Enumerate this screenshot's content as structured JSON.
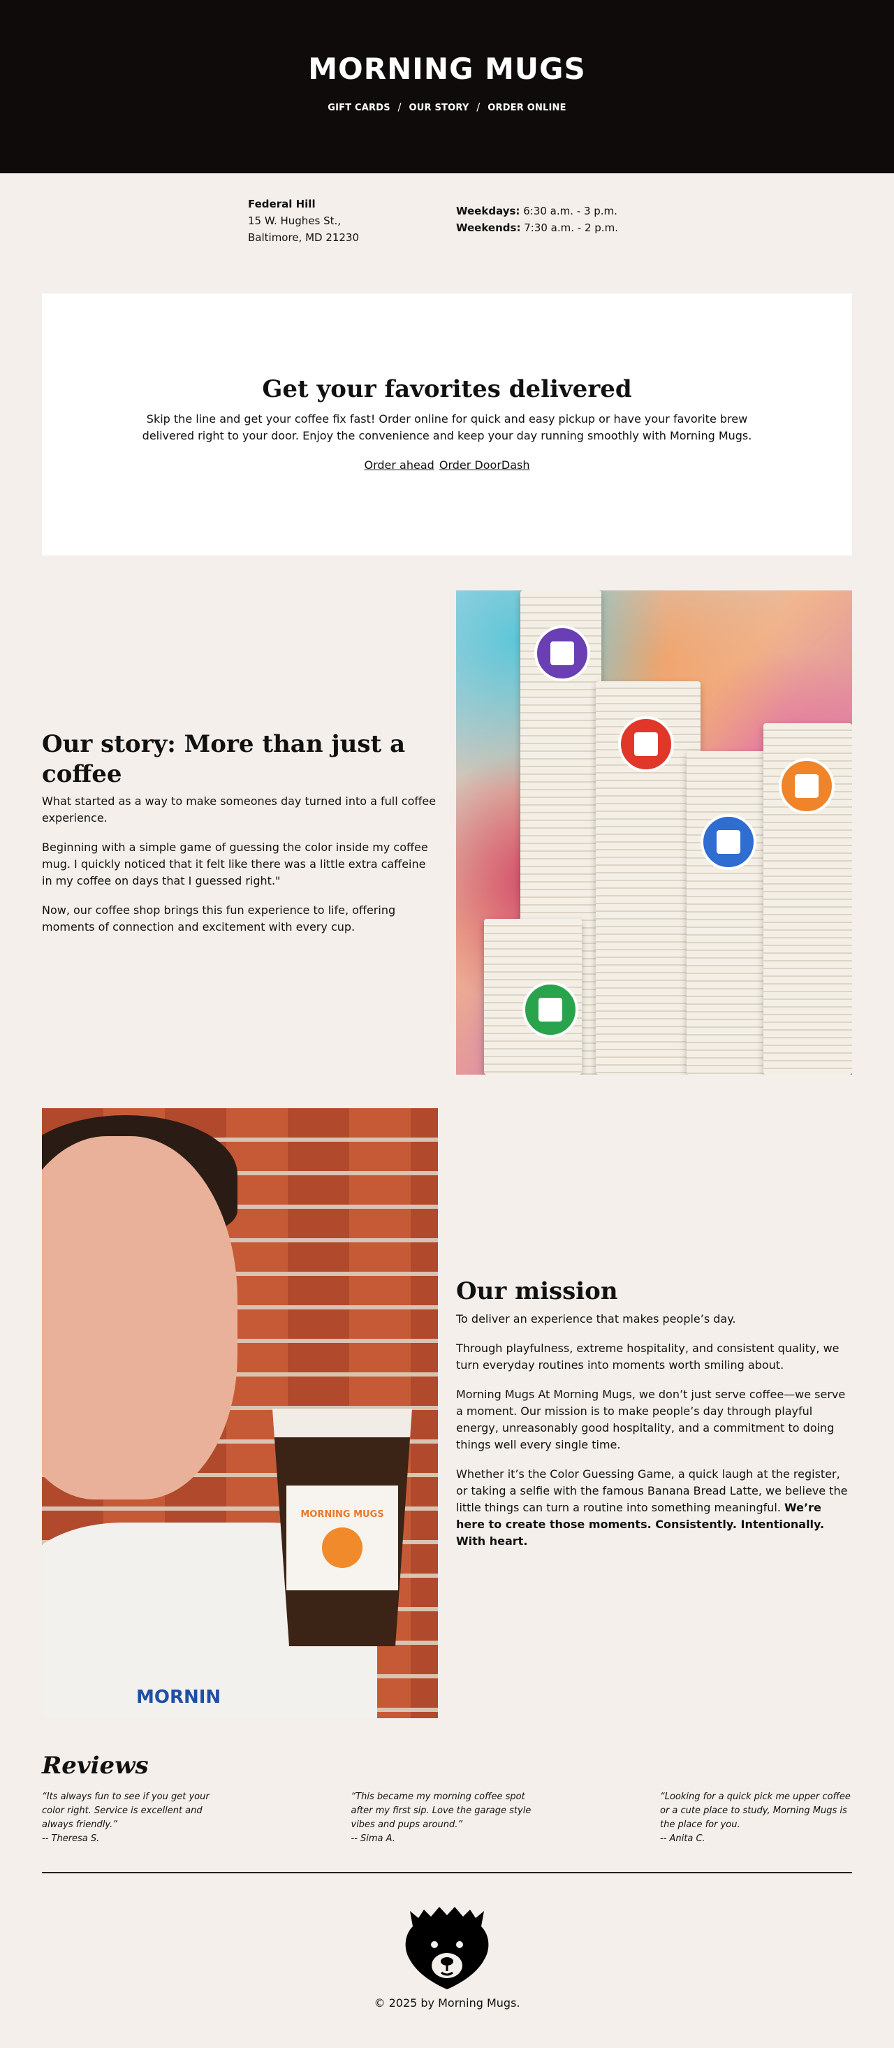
{
  "header": {
    "logo": "MORNING MUGS",
    "nav": [
      "GIFT CARDS",
      "OUR STORY",
      "ORDER ONLINE"
    ],
    "nav_separator": "/"
  },
  "info": {
    "location_name": "Federal Hill",
    "address_line1": "15 W. Hughes St.,",
    "address_line2": "Baltimore, MD 21230",
    "weekdays_label": "Weekdays:",
    "weekdays_hours": "6:30 a.m. - 3 p.m.",
    "weekends_label": "Weekends:",
    "weekends_hours": "7:30 a.m. - 2 p.m."
  },
  "delivery": {
    "title": "Get your favorites delivered",
    "body": "Skip the line and get your coffee fix fast! Order online for quick and easy pickup or have your favorite brew delivered right to your door. Enjoy the convenience and keep your day running smoothly with Morning Mugs.",
    "link_order_ahead": "Order ahead",
    "link_doordash": "Order DoorDash"
  },
  "story": {
    "title": "Our story: More than just a coffee",
    "p1": "What started as a way to make someones day turned into a full coffee experience.",
    "p2": "Beginning with a simple game of guessing the color inside my coffee mug. I quickly noticed that it felt like there was a little extra caffeine in my coffee on days that I guessed right.\"",
    "p3": "Now, our coffee shop brings this fun experience to life, offering moments of connection and excitement with every cup.",
    "badge_colors": [
      "#6a3fb3",
      "#e0372a",
      "#2f6dd0",
      "#f0842a",
      "#2aa34d"
    ]
  },
  "mission": {
    "title": "Our mission",
    "p1": "To deliver an experience that makes people’s day.",
    "p2": "Through playfulness, extreme hospitality, and consistent quality, we turn everyday routines into moments worth smiling about.",
    "p3": "Morning Mugs At Morning Mugs, we don’t just serve coffee—we serve a moment. Our mission is to make people’s day through playful energy, unreasonably good hospitality, and a commitment to doing things well every single time.",
    "p4_text": "Whether it’s the Color Guessing Game, a quick laugh at the register, or taking a selfie with the famous Banana Bread Latte, we believe the little things can turn a routine into something meaningful.",
    "p4_bold": "We’re here to create those moments. Consistently. Intentionally. With heart.",
    "cup_label": "MORNING MUGS",
    "shirt_text": "MORNIN"
  },
  "reviews": {
    "title": "Reviews",
    "items": [
      {
        "quote": "“Its always fun to see if you get your color right. Service is excellent and always friendly.”",
        "author": "-- Theresa S."
      },
      {
        "quote": "“This became my morning coffee spot after my first sip. Love the garage style vibes and pups around.”",
        "author": "-- Sima A."
      },
      {
        "quote": "“Looking for a quick pick me upper coffee or a cute place to study, Morning Mugs is the place for you.",
        "author": "-- Anita C."
      }
    ]
  },
  "footer": {
    "copyright": "© 2025 by Morning Mugs."
  }
}
